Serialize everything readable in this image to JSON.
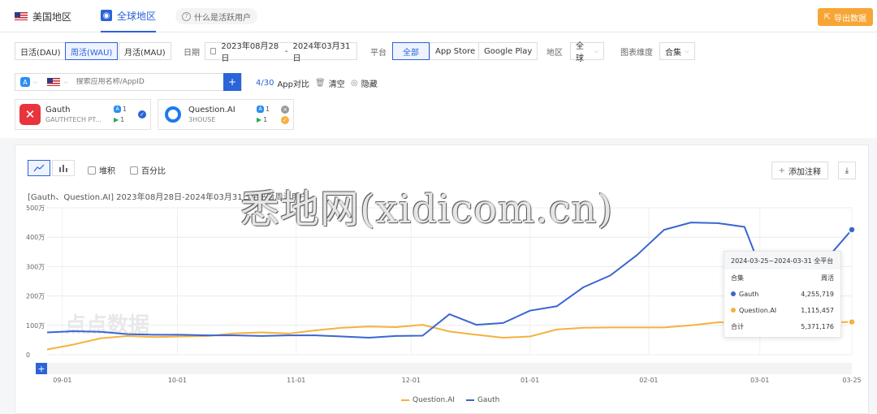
{
  "topbar": {
    "tabs": [
      {
        "label": "美国地区",
        "active": false
      },
      {
        "label": "全球地区",
        "active": true
      }
    ],
    "help": "什么是活跃用户",
    "export_label": "导出数据"
  },
  "filters": {
    "periods": [
      "日活(DAU)",
      "周活(WAU)",
      "月活(MAU)"
    ],
    "active_period": "周活(WAU)",
    "date_label": "日期",
    "date_start": "2023年08月28日",
    "date_sep": "-",
    "date_end": "2024年03月31日",
    "platform_label": "平台",
    "platforms": [
      "全部",
      "App Store",
      "Google Play"
    ],
    "active_platform": "全部",
    "region_label": "地区",
    "region_value": "全球",
    "dim_label": "图表维度",
    "dim_value": "合集"
  },
  "search": {
    "placeholder": "搜索应用名称/AppID"
  },
  "compare": {
    "count": "4/30",
    "label": "App对比",
    "clear": "清空",
    "hide": "隐藏"
  },
  "apps": [
    {
      "name": "Gauth",
      "developer": "GAUTHTECH PT...",
      "ios": "1",
      "android": "1",
      "color": "#e8343c"
    },
    {
      "name": "Question.AI",
      "developer": "3HOUSE",
      "ios": "1",
      "android": "1",
      "color": "#1f7ae8"
    }
  ],
  "chart_controls": {
    "stack": "堆积",
    "percent": "百分比",
    "add_note": "添加注释"
  },
  "chart_data": {
    "type": "line",
    "subtitle": "[Gauth、Question.AI]  2023年08月28日-2024年03月31日全平台周活用户",
    "x_ticks": [
      "09-01",
      "10-01",
      "11-01",
      "12-01",
      "01-01",
      "02-01",
      "03-01",
      "03-25"
    ],
    "y_ticks": [
      "0",
      "100万",
      "200万",
      "300万",
      "400万",
      "500万"
    ],
    "ylim": [
      0,
      5000000
    ],
    "x": [
      "2023-08-28",
      "2023-09-04",
      "2023-09-11",
      "2023-09-18",
      "2023-09-25",
      "2023-10-02",
      "2023-10-09",
      "2023-10-16",
      "2023-10-23",
      "2023-10-30",
      "2023-11-06",
      "2023-11-13",
      "2023-11-20",
      "2023-11-27",
      "2023-12-04",
      "2023-12-11",
      "2023-12-18",
      "2023-12-25",
      "2024-01-01",
      "2024-01-08",
      "2024-01-15",
      "2024-01-22",
      "2024-01-29",
      "2024-02-05",
      "2024-02-12",
      "2024-02-19",
      "2024-02-26",
      "2024-03-04",
      "2024-03-11",
      "2024-03-18",
      "2024-03-25"
    ],
    "series": [
      {
        "name": "Question.AI",
        "color": "#f5b13d",
        "values": [
          180000,
          350000,
          560000,
          640000,
          600000,
          620000,
          640000,
          730000,
          760000,
          720000,
          830000,
          920000,
          960000,
          940000,
          1020000,
          790000,
          680000,
          580000,
          620000,
          860000,
          920000,
          930000,
          930000,
          930000,
          1000000,
          1100000,
          1120000,
          1100000,
          1100000,
          1100000,
          1115457
        ]
      },
      {
        "name": "Gauth",
        "color": "#3a66cf",
        "values": [
          760000,
          800000,
          780000,
          700000,
          680000,
          680000,
          660000,
          660000,
          640000,
          660000,
          660000,
          620000,
          580000,
          640000,
          650000,
          1380000,
          1020000,
          1080000,
          1500000,
          1650000,
          2300000,
          2700000,
          3400000,
          4250000,
          4500000,
          4480000,
          4350000,
          2000000,
          1800000,
          3200000,
          4255719
        ]
      }
    ],
    "tooltip": {
      "title": "2024-03-25~2024-03-31 全平台",
      "col1": "合集",
      "col2": "周活",
      "rows": [
        {
          "name": "Gauth",
          "value": "4,255,719",
          "color": "#3a66cf"
        },
        {
          "name": "Question.AI",
          "value": "1,115,457",
          "color": "#f5b13d"
        },
        {
          "name": "合计",
          "value": "5,371,176",
          "color": ""
        }
      ]
    },
    "grid": true,
    "legend": "bottom-center"
  },
  "watermark": "悉地网(xidicom.cn)",
  "logo_watermark": "点点数据"
}
